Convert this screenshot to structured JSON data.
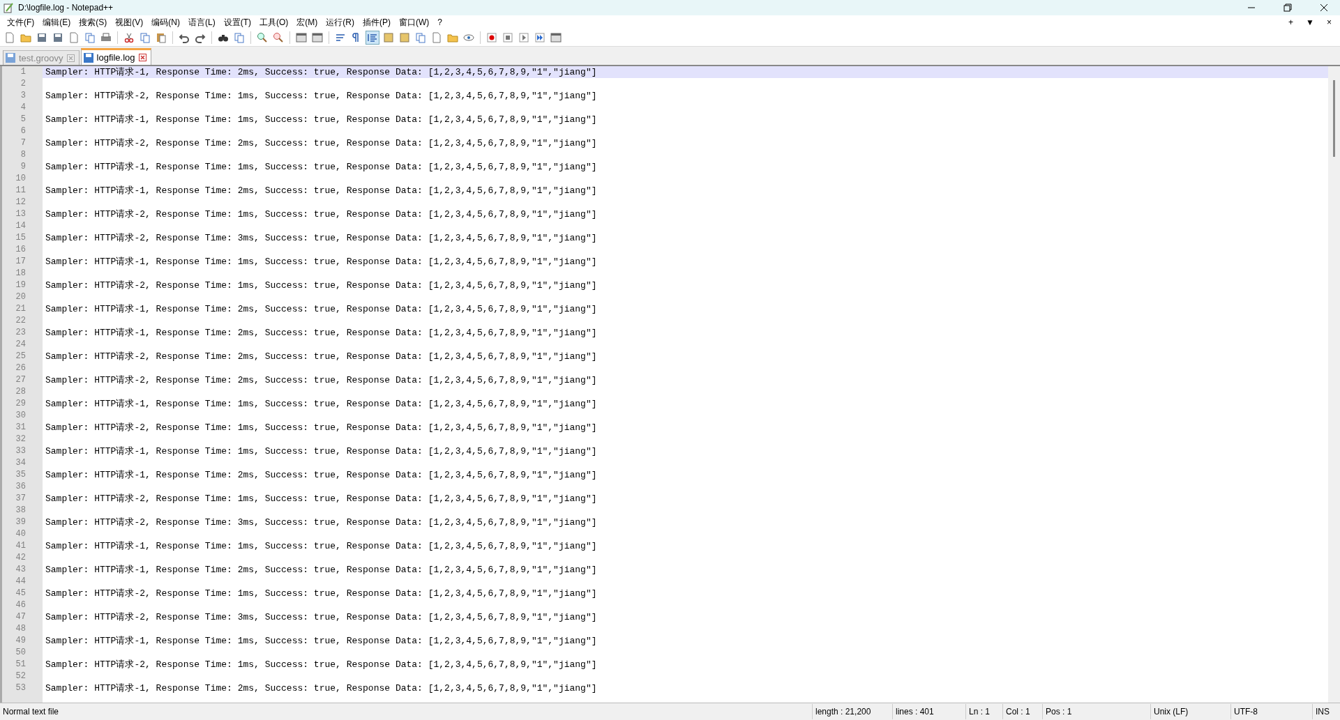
{
  "window": {
    "title": "D:\\logfile.log - Notepad++"
  },
  "menu": [
    "文件(F)",
    "编辑(E)",
    "搜索(S)",
    "视图(V)",
    "编码(N)",
    "语言(L)",
    "设置(T)",
    "工具(O)",
    "宏(M)",
    "运行(R)",
    "插件(P)",
    "窗口(W)",
    "?"
  ],
  "menu_right": [
    "+",
    "▼",
    "×"
  ],
  "tabs": [
    {
      "label": "test.groovy",
      "selected": false
    },
    {
      "label": "logfile.log",
      "selected": true
    }
  ],
  "editor": {
    "lines": [
      {
        "number": "1",
        "text": "Sampler: HTTP请求-1, Response Time: 2ms, Success: true, Response Data: [1,2,3,4,5,6,7,8,9,\"1\",\"jiang\"]",
        "current": true
      },
      {
        "number": "2",
        "current": false
      },
      {
        "number": "3",
        "text": "Sampler: HTTP请求-2, Response Time: 1ms, Success: true, Response Data: [1,2,3,4,5,6,7,8,9,\"1\",\"jiang\"]",
        "current": false
      },
      {
        "number": "4",
        "current": false
      },
      {
        "number": "5",
        "text": "Sampler: HTTP请求-1, Response Time: 1ms, Success: true, Response Data: [1,2,3,4,5,6,7,8,9,\"1\",\"jiang\"]",
        "current": false
      },
      {
        "number": "6",
        "current": false
      },
      {
        "number": "7",
        "text": "Sampler: HTTP请求-2, Response Time: 2ms, Success: true, Response Data: [1,2,3,4,5,6,7,8,9,\"1\",\"jiang\"]",
        "current": false
      },
      {
        "number": "8",
        "current": false
      },
      {
        "number": "9",
        "text": "Sampler: HTTP请求-1, Response Time: 1ms, Success: true, Response Data: [1,2,3,4,5,6,7,8,9,\"1\",\"jiang\"]",
        "current": false
      },
      {
        "number": "10",
        "current": false
      },
      {
        "number": "11",
        "text": "Sampler: HTTP请求-1, Response Time: 2ms, Success: true, Response Data: [1,2,3,4,5,6,7,8,9,\"1\",\"jiang\"]",
        "current": false
      },
      {
        "number": "12",
        "current": false
      },
      {
        "number": "13",
        "text": "Sampler: HTTP请求-2, Response Time: 1ms, Success: true, Response Data: [1,2,3,4,5,6,7,8,9,\"1\",\"jiang\"]",
        "current": false
      },
      {
        "number": "14",
        "current": false
      },
      {
        "number": "15",
        "text": "Sampler: HTTP请求-2, Response Time: 3ms, Success: true, Response Data: [1,2,3,4,5,6,7,8,9,\"1\",\"jiang\"]",
        "current": false
      },
      {
        "number": "16",
        "current": false
      },
      {
        "number": "17",
        "text": "Sampler: HTTP请求-1, Response Time: 1ms, Success: true, Response Data: [1,2,3,4,5,6,7,8,9,\"1\",\"jiang\"]",
        "current": false
      },
      {
        "number": "18",
        "current": false
      },
      {
        "number": "19",
        "text": "Sampler: HTTP请求-2, Response Time: 1ms, Success: true, Response Data: [1,2,3,4,5,6,7,8,9,\"1\",\"jiang\"]",
        "current": false
      },
      {
        "number": "20",
        "current": false
      },
      {
        "number": "21",
        "text": "Sampler: HTTP请求-1, Response Time: 2ms, Success: true, Response Data: [1,2,3,4,5,6,7,8,9,\"1\",\"jiang\"]",
        "current": false
      },
      {
        "number": "22",
        "current": false
      },
      {
        "number": "23",
        "text": "Sampler: HTTP请求-1, Response Time: 2ms, Success: true, Response Data: [1,2,3,4,5,6,7,8,9,\"1\",\"jiang\"]",
        "current": false
      },
      {
        "number": "24",
        "current": false
      },
      {
        "number": "25",
        "text": "Sampler: HTTP请求-2, Response Time: 2ms, Success: true, Response Data: [1,2,3,4,5,6,7,8,9,\"1\",\"jiang\"]",
        "current": false
      },
      {
        "number": "26",
        "current": false
      },
      {
        "number": "27",
        "text": "Sampler: HTTP请求-2, Response Time: 2ms, Success: true, Response Data: [1,2,3,4,5,6,7,8,9,\"1\",\"jiang\"]",
        "current": false
      },
      {
        "number": "28",
        "current": false
      },
      {
        "number": "29",
        "text": "Sampler: HTTP请求-1, Response Time: 1ms, Success: true, Response Data: [1,2,3,4,5,6,7,8,9,\"1\",\"jiang\"]",
        "current": false
      },
      {
        "number": "30",
        "current": false
      },
      {
        "number": "31",
        "text": "Sampler: HTTP请求-2, Response Time: 1ms, Success: true, Response Data: [1,2,3,4,5,6,7,8,9,\"1\",\"jiang\"]",
        "current": false
      },
      {
        "number": "32",
        "current": false
      },
      {
        "number": "33",
        "text": "Sampler: HTTP请求-1, Response Time: 1ms, Success: true, Response Data: [1,2,3,4,5,6,7,8,9,\"1\",\"jiang\"]",
        "current": false
      },
      {
        "number": "34",
        "current": false
      },
      {
        "number": "35",
        "text": "Sampler: HTTP请求-1, Response Time: 2ms, Success: true, Response Data: [1,2,3,4,5,6,7,8,9,\"1\",\"jiang\"]",
        "current": false
      },
      {
        "number": "36",
        "current": false
      },
      {
        "number": "37",
        "text": "Sampler: HTTP请求-2, Response Time: 1ms, Success: true, Response Data: [1,2,3,4,5,6,7,8,9,\"1\",\"jiang\"]",
        "current": false
      },
      {
        "number": "38",
        "current": false
      },
      {
        "number": "39",
        "text": "Sampler: HTTP请求-2, Response Time: 3ms, Success: true, Response Data: [1,2,3,4,5,6,7,8,9,\"1\",\"jiang\"]",
        "current": false
      },
      {
        "number": "40",
        "current": false
      },
      {
        "number": "41",
        "text": "Sampler: HTTP请求-1, Response Time: 1ms, Success: true, Response Data: [1,2,3,4,5,6,7,8,9,\"1\",\"jiang\"]",
        "current": false
      },
      {
        "number": "42",
        "current": false
      },
      {
        "number": "43",
        "text": "Sampler: HTTP请求-1, Response Time: 2ms, Success: true, Response Data: [1,2,3,4,5,6,7,8,9,\"1\",\"jiang\"]",
        "current": false
      },
      {
        "number": "44",
        "current": false
      },
      {
        "number": "45",
        "text": "Sampler: HTTP请求-2, Response Time: 1ms, Success: true, Response Data: [1,2,3,4,5,6,7,8,9,\"1\",\"jiang\"]",
        "current": false
      },
      {
        "number": "46",
        "current": false
      },
      {
        "number": "47",
        "text": "Sampler: HTTP请求-2, Response Time: 3ms, Success: true, Response Data: [1,2,3,4,5,6,7,8,9,\"1\",\"jiang\"]",
        "current": false
      },
      {
        "number": "48",
        "current": false
      },
      {
        "number": "49",
        "text": "Sampler: HTTP请求-1, Response Time: 1ms, Success: true, Response Data: [1,2,3,4,5,6,7,8,9,\"1\",\"jiang\"]",
        "current": false
      },
      {
        "number": "50",
        "current": false
      },
      {
        "number": "51",
        "text": "Sampler: HTTP请求-2, Response Time: 1ms, Success: true, Response Data: [1,2,3,4,5,6,7,8,9,\"1\",\"jiang\"]",
        "current": false
      },
      {
        "number": "52",
        "current": false
      },
      {
        "number": "53",
        "text": "Sampler: HTTP请求-1, Response Time: 2ms, Success: true, Response Data: [1,2,3,4,5,6,7,8,9,\"1\",\"jiang\"]",
        "current": false
      }
    ]
  },
  "status_bar": {
    "file_type": "Normal text file",
    "length": "length : 21,200",
    "lines": "lines : 401",
    "line": "Ln : 1",
    "column": "Col : 1",
    "position": "Pos : 1",
    "eol": "Unix (LF)",
    "encoding": "UTF-8",
    "mode": "INS"
  }
}
